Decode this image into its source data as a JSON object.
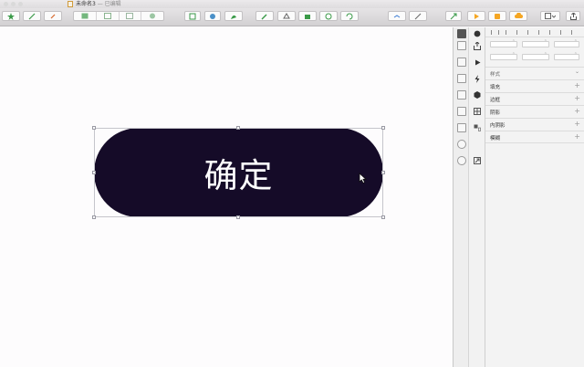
{
  "window": {
    "title": "未命名3",
    "status": " — 已编辑"
  },
  "canvas": {
    "button_label": "确定",
    "button_fill": "#150b28"
  },
  "inspector": {
    "style_header": "样式",
    "sections": [
      {
        "label": "填充"
      },
      {
        "label": "边框"
      },
      {
        "label": "阴影"
      },
      {
        "label": "内阴影"
      },
      {
        "label": "模糊"
      }
    ]
  },
  "icons": {
    "toolbar": [
      "insert-icon",
      "pencil-icon",
      "text-icon",
      "group-icon",
      "ungroup-icon",
      "symbol-icon",
      "create-symbol-icon",
      "rectangle-icon",
      "oval-icon",
      "vector-icon",
      "edit-icon",
      "rotate-icon",
      "flatten-icon",
      "mask-icon",
      "scale-icon",
      "union-icon",
      "subtract-icon",
      "play-icon",
      "mirror-icon",
      "cloud-icon",
      "view-icon",
      "export-icon"
    ]
  },
  "colors": {
    "accent_orange": "#f5a623",
    "accent_blue": "#3a7bd5",
    "toolbar_green": "#3a9a48"
  }
}
